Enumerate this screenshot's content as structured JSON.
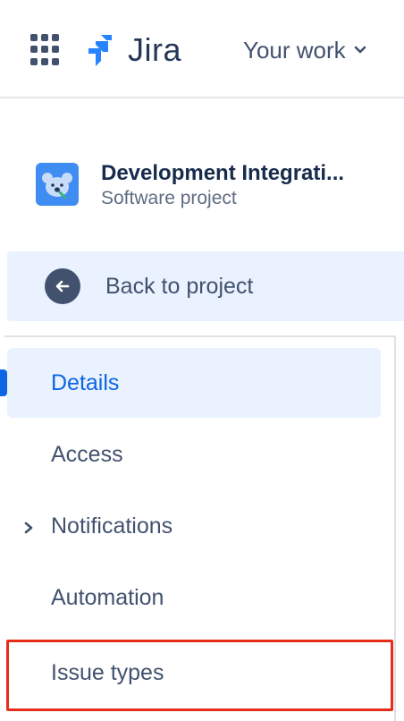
{
  "header": {
    "logo_text": "Jira",
    "your_work_label": "Your work"
  },
  "project": {
    "name": "Development Integrati...",
    "type": "Software project"
  },
  "back": {
    "label": "Back to project"
  },
  "nav": {
    "items": [
      {
        "label": "Details",
        "selected": true
      },
      {
        "label": "Access"
      },
      {
        "label": "Notifications",
        "expandable": true
      },
      {
        "label": "Automation"
      },
      {
        "label": "Issue types",
        "highlighted": true
      }
    ]
  },
  "colors": {
    "accent": "#0c66e4",
    "highlight_border": "#e52d1a",
    "selected_bg": "#e9f2fe"
  }
}
